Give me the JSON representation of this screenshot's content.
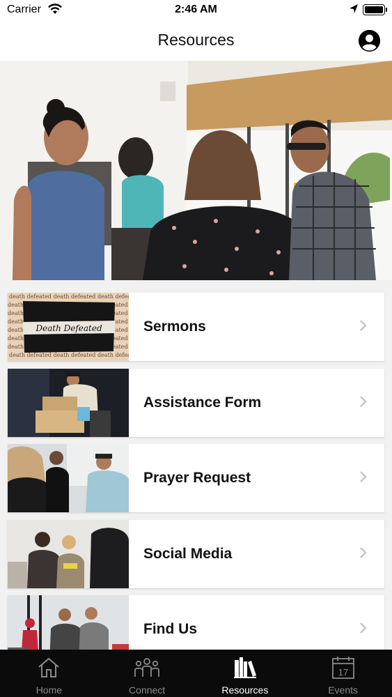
{
  "status_bar": {
    "carrier": "Carrier",
    "time": "2:46 AM"
  },
  "nav": {
    "title": "Resources"
  },
  "resources": [
    {
      "label": "Sermons",
      "thumb_text": "Death Defeated",
      "pattern_text": "death defeated"
    },
    {
      "label": "Assistance Form"
    },
    {
      "label": "Prayer Request"
    },
    {
      "label": "Social Media"
    },
    {
      "label": "Find Us"
    }
  ],
  "tabs": [
    {
      "label": "Home",
      "icon": "home-icon"
    },
    {
      "label": "Connect",
      "icon": "people-icon"
    },
    {
      "label": "Resources",
      "icon": "library-icon",
      "active": true
    },
    {
      "label": "Events",
      "icon": "calendar-icon",
      "calendar_day": "17"
    }
  ]
}
